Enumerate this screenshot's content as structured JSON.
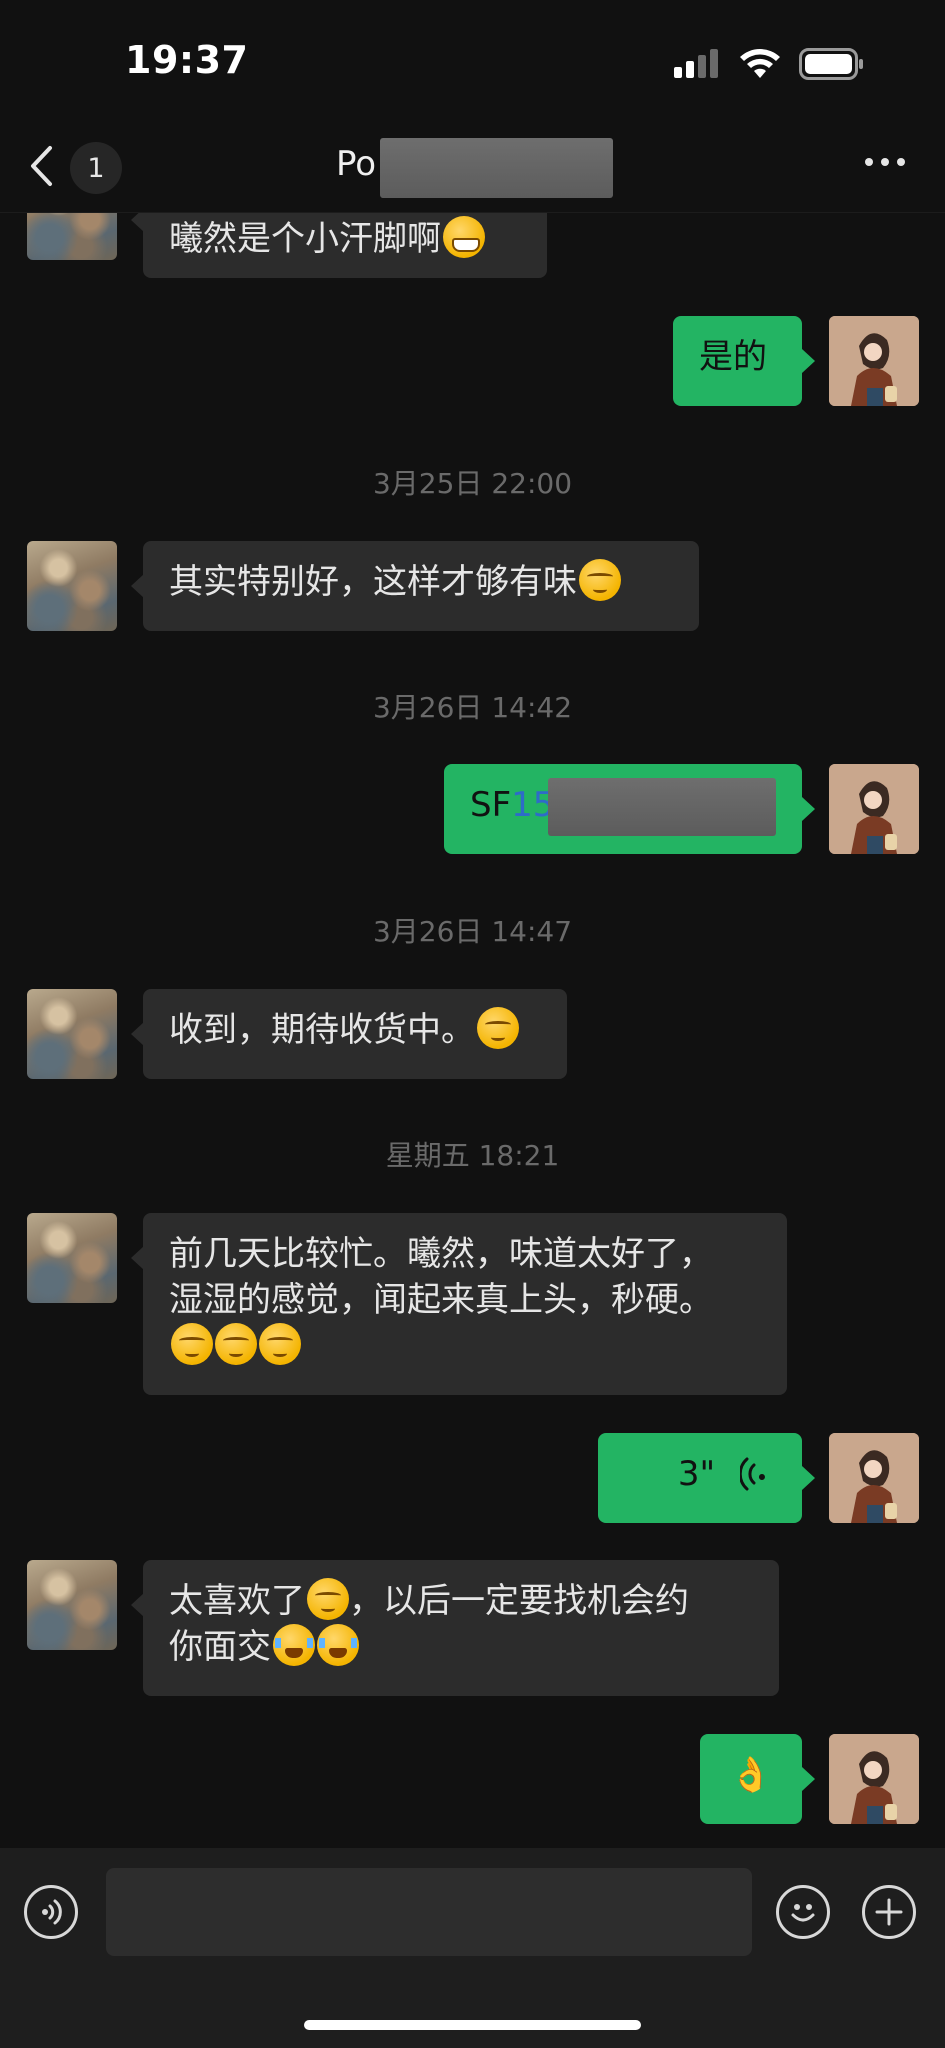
{
  "status_bar": {
    "time": "19:37",
    "icons": [
      "cellular-signal-icon",
      "wifi-icon",
      "battery-icon"
    ]
  },
  "nav": {
    "back_icon": "chevron-left-icon",
    "unread_count": "1",
    "title_visible": "Po",
    "more_icon": "ellipsis-icon"
  },
  "colors": {
    "background": "#111111",
    "incoming_bubble": "#2c2c2c",
    "outgoing_bubble": "#23b463",
    "timestamp_text": "#6a6a6a"
  },
  "messages": [
    {
      "kind": "in",
      "text": "曦然是个小汗脚啊",
      "emoji": [
        "grin"
      ]
    },
    {
      "kind": "out",
      "text": "是的"
    },
    {
      "kind": "timestamp",
      "text": "3月25日 22:00"
    },
    {
      "kind": "in",
      "text": "其实特别好，这样才够有味",
      "emoji": [
        "smirk"
      ]
    },
    {
      "kind": "timestamp",
      "text": "3月26日 14:42"
    },
    {
      "kind": "out",
      "text_prefix": "SF",
      "text_link": "15"
    },
    {
      "kind": "timestamp",
      "text": "3月26日 14:47"
    },
    {
      "kind": "in",
      "text": "收到，期待收货中。",
      "emoji": [
        "smirk"
      ]
    },
    {
      "kind": "timestamp",
      "text": "星期五 18:21"
    },
    {
      "kind": "in",
      "lines": [
        "前几天比较忙。曦然，味道太好了，",
        "湿湿的感觉，闻起来真上头，秒硬。"
      ],
      "emoji": [
        "smirk",
        "smirk",
        "smirk"
      ]
    },
    {
      "kind": "out-voice",
      "duration": "3\"",
      "icon": "voice-wave-icon"
    },
    {
      "kind": "in",
      "lines": [
        "太喜欢了",
        "，以后一定要找机会约",
        "你面交"
      ],
      "emoji": [
        "smirk",
        "cry",
        "cry"
      ]
    },
    {
      "kind": "out",
      "emoji_text": "👌"
    }
  ],
  "input_bar": {
    "voice_icon": "voice-input-icon",
    "emoji_icon": "emoji-icon",
    "add_icon": "plus-icon",
    "placeholder": ""
  }
}
